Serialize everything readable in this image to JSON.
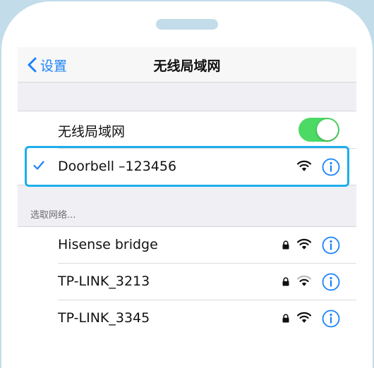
{
  "nav": {
    "back_label": "设置",
    "title": "无线局域网"
  },
  "wifi_toggle": {
    "label": "无线局域网",
    "state": "on",
    "color": "#4cd964"
  },
  "connected": {
    "name": "Doorbell –123456",
    "secured": false,
    "highlight_color": "#1eaeeb"
  },
  "section_header": "选取网络...",
  "networks": [
    {
      "name": "Hisense bridge",
      "locked": true,
      "signal": "full"
    },
    {
      "name": "TP-LINK_3213",
      "locked": true,
      "signal": "medium"
    },
    {
      "name": "TP-LINK_3345",
      "locked": true,
      "signal": "full"
    }
  ],
  "accent_color": "#1a82fb"
}
